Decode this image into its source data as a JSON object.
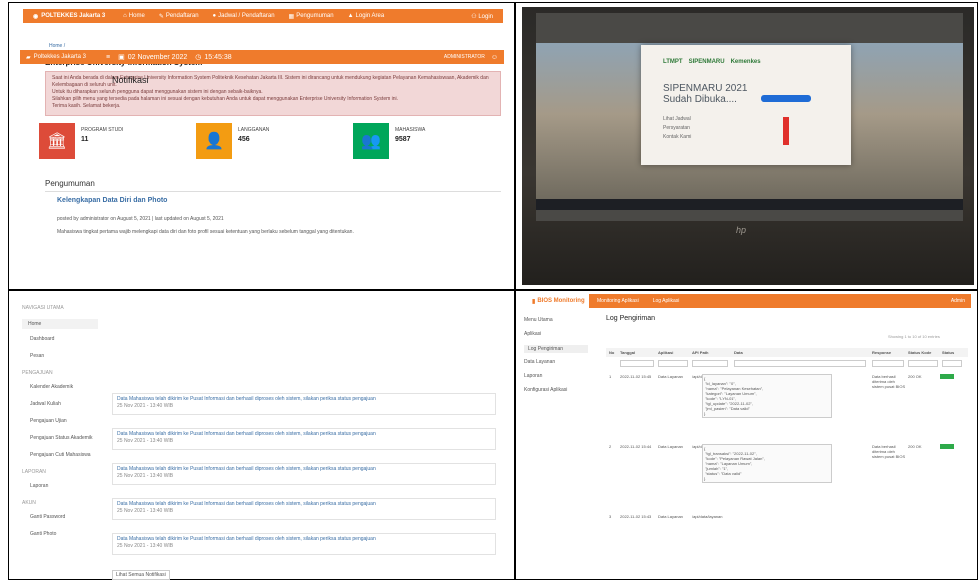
{
  "p1": {
    "brand": "POLTEKKES Jakarta 3",
    "nav": [
      "Home",
      "Pendaftaran",
      "Jadwal / Pendaftaran",
      "Pengumuman",
      "Login Area"
    ],
    "nav_right": "Login",
    "breadcrumb": "Home /",
    "title": "Enterprise University Information System",
    "alert": [
      "Saat ini Anda berada di dalam Enterprise University Information System Politeknik Kesehatan Jakarta III. Sistem ini dirancang untuk mendukung kegiatan Pelayanan Kemahasiswaan, Akademik dan Kelembagaan di seluruh unit.",
      "Untuk itu diharapkan seluruh pengguna dapat menggunakan sistem ini dengan sebaik-baiknya.",
      "Silahkan pilih menu yang tersedia pada halaman ini sesuai dengan kebutuhan Anda untuk dapat menggunakan Enterprise University Information System ini.",
      "Terima kasih. Selamat bekerja."
    ],
    "stats": [
      {
        "label": "PROGRAM STUDI",
        "value": "11",
        "color": "#dd4b39",
        "icon": "bank-icon"
      },
      {
        "label": "LANGGANAN",
        "value": "456",
        "color": "#f39c12",
        "icon": "user-icon"
      },
      {
        "label": "MAHASISWA",
        "value": "9587",
        "color": "#00a65a",
        "icon": "users-icon"
      }
    ],
    "section": "Pengumuman",
    "post_title": "Kelengkapan Data Diri dan Photo",
    "post_meta": "posted by administrator on August 5, 2021 | last updated on August 5, 2021",
    "post_desc": "Mahasiswa tingkat pertama wajib melengkapi data diri dan foto profil sesuai ketentuan yang berlaku sebelum tanggal yang ditentukan."
  },
  "p2": {
    "logos": [
      "LTMPT",
      "SIPENMARU",
      "Kemenkes"
    ],
    "headline": "SIPENMARU 2021",
    "subline": "Sudah Dibuka....",
    "links": [
      "Lihat Jadwal",
      "Persyaratan",
      "Kontak Kami"
    ],
    "brand_mark": "hp"
  },
  "p3": {
    "brand": "Poltekkes Jakarta 3",
    "date": "02 November 2022",
    "time": "15:45:38",
    "user": "ADMINISTRATOR",
    "title": "Notifikasi",
    "menu": [
      {
        "label": "NAVIGASI UTAMA",
        "type": "sec"
      },
      {
        "label": "Home",
        "type": "active"
      },
      {
        "label": "Dashboard",
        "type": "item"
      },
      {
        "label": "Pesan",
        "type": "item"
      },
      {
        "label": "PENGAJUAN",
        "type": "sec"
      },
      {
        "label": "Kalender Akademik",
        "type": "item"
      },
      {
        "label": "Jadwal Kuliah",
        "type": "item"
      },
      {
        "label": "Pengajuan Ujian",
        "type": "item"
      },
      {
        "label": "Pengajuan Status Akademik",
        "type": "item"
      },
      {
        "label": "Pengajuan Cuti Mahasiswa",
        "type": "item"
      },
      {
        "label": "LAPORAN",
        "type": "sec"
      },
      {
        "label": "Laporan",
        "type": "item"
      },
      {
        "label": "AKUN",
        "type": "sec"
      },
      {
        "label": "Ganti Password",
        "type": "item"
      },
      {
        "label": "Ganti Photo",
        "type": "item"
      }
    ],
    "notifs": [
      {
        "text": "Data Mahasiswa telah dikirim ke Pusat Informasi dan berhasil diproses oleh sistem, silakan periksa status pengajuan",
        "date": "25 Nov 2021 - 13:40 WIB"
      },
      {
        "text": "Data Mahasiswa telah dikirim ke Pusat Informasi dan berhasil diproses oleh sistem, silakan periksa status pengajuan",
        "date": "25 Nov 2021 - 13:40 WIB"
      },
      {
        "text": "Data Mahasiswa telah dikirim ke Pusat Informasi dan berhasil diproses oleh sistem, silakan periksa status pengajuan",
        "date": "25 Nov 2021 - 13:40 WIB"
      },
      {
        "text": "Data Mahasiswa telah dikirim ke Pusat Informasi dan berhasil diproses oleh sistem, silakan periksa status pengajuan",
        "date": "25 Nov 2021 - 13:40 WIB"
      },
      {
        "text": "Data Mahasiswa telah dikirim ke Pusat Informasi dan berhasil diproses oleh sistem, silakan periksa status pengajuan",
        "date": "25 Nov 2021 - 13:40 WIB"
      }
    ],
    "more_button": "Lihat Semua Notifikasi"
  },
  "p4": {
    "brand": "BIOS Monitoring",
    "top_items": [
      "Monitoring Aplikasi",
      "Log Aplikasi"
    ],
    "top_right": "Admin",
    "side": [
      {
        "label": "Menu Utama",
        "active": false
      },
      {
        "label": "Aplikasi",
        "active": false
      },
      {
        "label": "Log Pengiriman",
        "active": true
      },
      {
        "label": "Data Layanan",
        "active": false
      },
      {
        "label": "Laporan",
        "active": false
      },
      {
        "label": "Konfigurasi Aplikasi",
        "active": false
      }
    ],
    "title": "Log Pengiriman",
    "count": "Showing 1 to 10 of 10 entries",
    "headers": [
      "No",
      "Tanggal",
      "Aplikasi",
      "API Path",
      "Data",
      "Response",
      "Status Kode",
      "Status"
    ],
    "rows": [
      {
        "no": "1",
        "tgl": "2022-11-02 15:45",
        "app": "Data Layanan",
        "path": "/api/data/layanan/input",
        "json": "{\n \"id_layanan\": \"0\",\n \"nama\": \"Pelayanan Kesehatan\",\n \"kategori\": \"Layanan Umum\",\n \"kode\": \"LYN-01\",\n \"tgl_update\": \"2022-11-02\",\n \"jml_pasien\": \"Data valid\"\n}",
        "resp": "Data berhasil diterima oleh sistem pusat BIOS",
        "code": "200 OK"
      },
      {
        "no": "2",
        "tgl": "2022-11-02 15:44",
        "app": "Data Layanan",
        "path": "/api/data/layanan/input",
        "json": "{\n \"tgl_transaksi\": \"2022-11-02\",\n \"kode\": \"Pelayanan Rawat Jalan\",\n \"nama\": \"Layanan Umum\",\n \"jumlah\": \"1\",\n \"status\": \"Data valid\"\n}",
        "resp": "Data berhasil diterima oleh sistem pusat BIOS",
        "code": "200 OK"
      },
      {
        "no": "3",
        "tgl": "2022-11-02 15:43",
        "app": "Data Layanan",
        "path": "/api/data/layanan",
        "json": "",
        "resp": "",
        "code": ""
      }
    ]
  }
}
